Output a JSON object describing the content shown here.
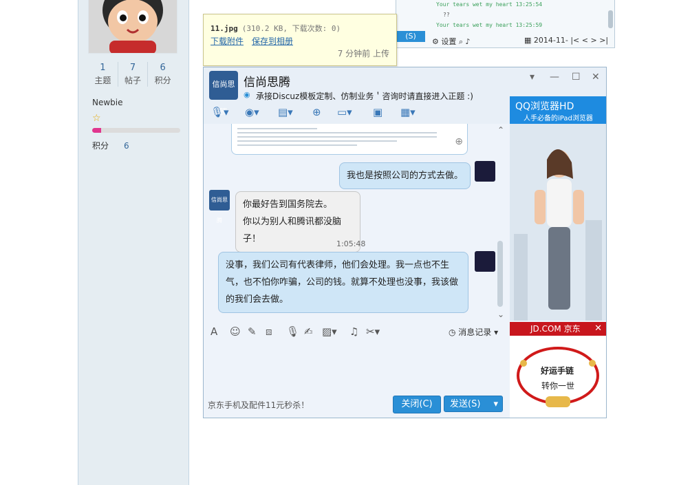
{
  "profile": {
    "stats": [
      {
        "num": "1",
        "label": "主题"
      },
      {
        "num": "7",
        "label": "帖子"
      },
      {
        "num": "6",
        "label": "积分"
      }
    ],
    "rank": "Newbie",
    "progress_fraction": 0.1,
    "credit_label": "积分",
    "credit_value": "6"
  },
  "bg_window": {
    "log1": "Your tears wet my heart 13:25:54",
    "log2": "??",
    "log3": "Your tears wet my heart 13:25:59",
    "send": "(S)",
    "settings": "设置",
    "date": "2014-11-"
  },
  "tooltip": {
    "filename": "11.jpg",
    "meta": "(310.2 KB, 下载次数: 0)",
    "download": "下载附件",
    "save": "保存到相册",
    "age": "7 分钟前 上传"
  },
  "qq": {
    "group_icon_text": "信尚思腾",
    "title": "信尚思腾",
    "subtitle": "承接Discuz模板定制、仿制业务＇咨询时请直接进入正题 :)",
    "messages": {
      "me1": "我也是按照公司的方式去做。",
      "in1a": "你最好告到国务院去。",
      "in1b": "你以为别人和腾讯都没脑子！",
      "timestamp": "1:05:48",
      "me2a": "没事，我们公司有代表律师，他们会处理。我一点也不生",
      "me2b": "气，也不怕你咋骗，公司的钱。就算不处理也没事，我该做",
      "me2c": "的我们会去做。"
    },
    "history": "消息记录",
    "ad_text": "京东手机及配件11元秒杀！",
    "close_btn": "关闭(C)",
    "send_btn": "发送(S)",
    "ad_browser_title": "QQ浏览器HD",
    "ad_browser_sub": "人手必备的iPad浏览器",
    "ad_jd": "JD.COM 京东",
    "ad_jd_t1": "好运手链",
    "ad_jd_t2": "转你一世"
  },
  "colors": {
    "accent": "#2a8fd6",
    "link": "#2366a8",
    "progress": "#e0368e"
  }
}
